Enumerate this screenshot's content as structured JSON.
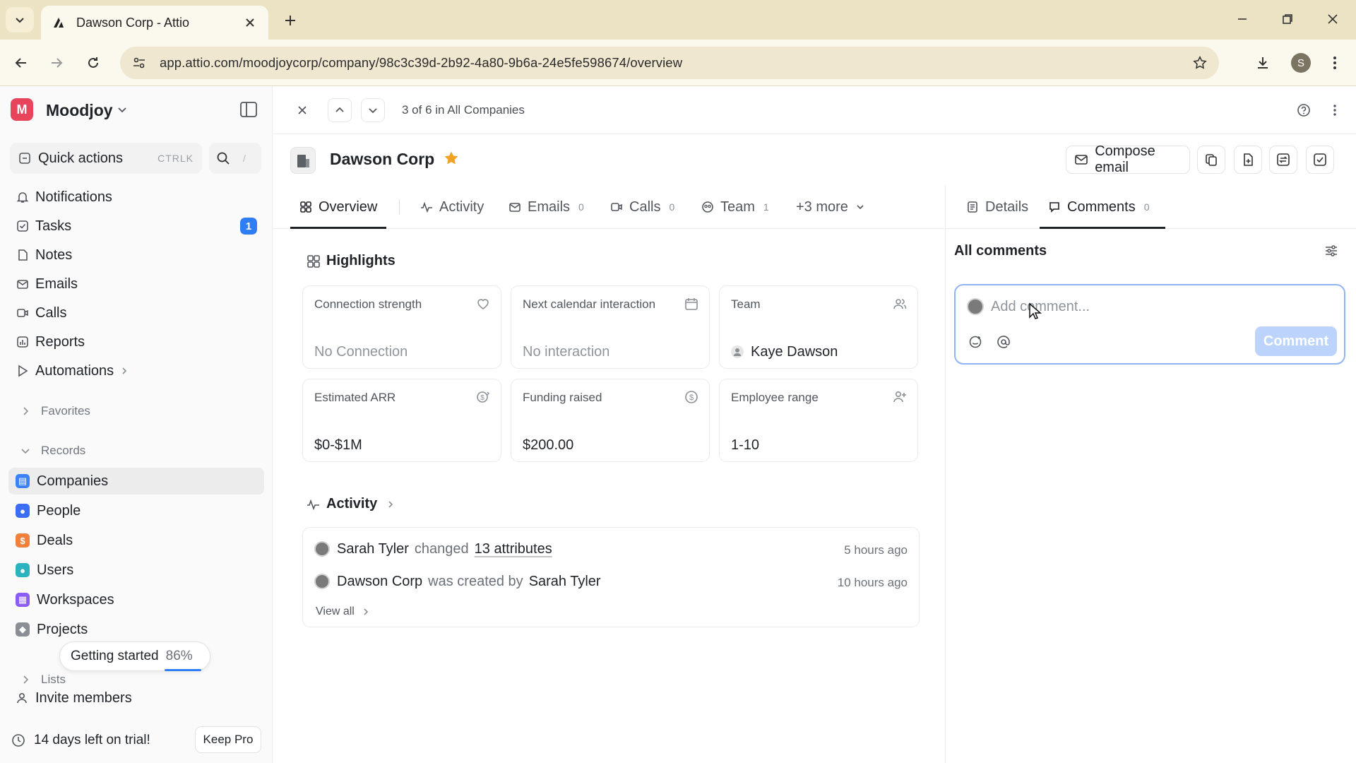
{
  "browser": {
    "tab_title": "Dawson Corp - Attio",
    "url": "app.attio.com/moodjoycorp/company/98c3c39d-2b92-4a80-9b6a-24e5fe598674/overview",
    "profile_initial": "S"
  },
  "sidebar": {
    "workspace_initial": "M",
    "workspace_name": "Moodjoy",
    "quick_actions": {
      "label": "Quick actions",
      "shortcut": "CTRLK"
    },
    "search_shortcut": "/",
    "nav": [
      {
        "label": "Notifications",
        "icon": "bell-icon"
      },
      {
        "label": "Tasks",
        "icon": "check-square-icon",
        "badge": "1"
      },
      {
        "label": "Notes",
        "icon": "note-icon"
      },
      {
        "label": "Emails",
        "icon": "mail-icon"
      },
      {
        "label": "Calls",
        "icon": "video-icon"
      },
      {
        "label": "Reports",
        "icon": "chart-icon"
      },
      {
        "label": "Automations",
        "icon": "play-icon"
      }
    ],
    "favorites_label": "Favorites",
    "records_label": "Records",
    "records": [
      {
        "label": "Companies",
        "color": "#3b82f6"
      },
      {
        "label": "People",
        "color": "#3b6ef5"
      },
      {
        "label": "Deals",
        "color": "#f0803c"
      },
      {
        "label": "Users",
        "color": "#2bb3c0"
      },
      {
        "label": "Workspaces",
        "color": "#8b5cf6"
      },
      {
        "label": "Projects",
        "color": "#8a8f96"
      }
    ],
    "lists_label": "Lists",
    "invite_label": "Invite members",
    "getting_started": {
      "label": "Getting started",
      "percent": "86%",
      "progress": 0.86
    },
    "trial_text": "14 days left on trial!",
    "keep_pro": "Keep Pro"
  },
  "header": {
    "pager": "3 of 6 in All Companies"
  },
  "record": {
    "name": "Dawson Corp",
    "starred": true,
    "compose_email": "Compose email"
  },
  "tabs": [
    {
      "label": "Overview",
      "count": ""
    },
    {
      "label": "Activity",
      "count": ""
    },
    {
      "label": "Emails",
      "count": "0"
    },
    {
      "label": "Calls",
      "count": "0"
    },
    {
      "label": "Team",
      "count": "1"
    },
    {
      "label": "+3 more",
      "count": ""
    }
  ],
  "right_tabs": [
    {
      "label": "Details",
      "count": ""
    },
    {
      "label": "Comments",
      "count": "0"
    }
  ],
  "highlights": {
    "title": "Highlights",
    "cards": [
      {
        "label": "Connection strength",
        "value": "No Connection",
        "icon": "heart-icon"
      },
      {
        "label": "Next calendar interaction",
        "value": "No interaction",
        "icon": "calendar-icon"
      },
      {
        "label": "Team",
        "value": "Kaye Dawson",
        "icon": "users-icon"
      },
      {
        "label": "Estimated ARR",
        "value": "$0-$1M",
        "icon": "dollar-growth-icon"
      },
      {
        "label": "Funding raised",
        "value": "$200.00",
        "icon": "dollar-circle-icon"
      },
      {
        "label": "Employee range",
        "value": "1-10",
        "icon": "user-plus-icon"
      }
    ]
  },
  "activity": {
    "title": "Activity",
    "rows": [
      {
        "actor": "Sarah Tyler",
        "verb": "changed",
        "object": "13 attributes",
        "time": "5 hours ago"
      },
      {
        "actor": "Dawson Corp",
        "verb": "was created by",
        "object": "Sarah Tyler",
        "time": "10 hours ago"
      }
    ],
    "view_all": "View all"
  },
  "comments": {
    "title": "All comments",
    "placeholder": "Add comment...",
    "submit": "Comment"
  }
}
